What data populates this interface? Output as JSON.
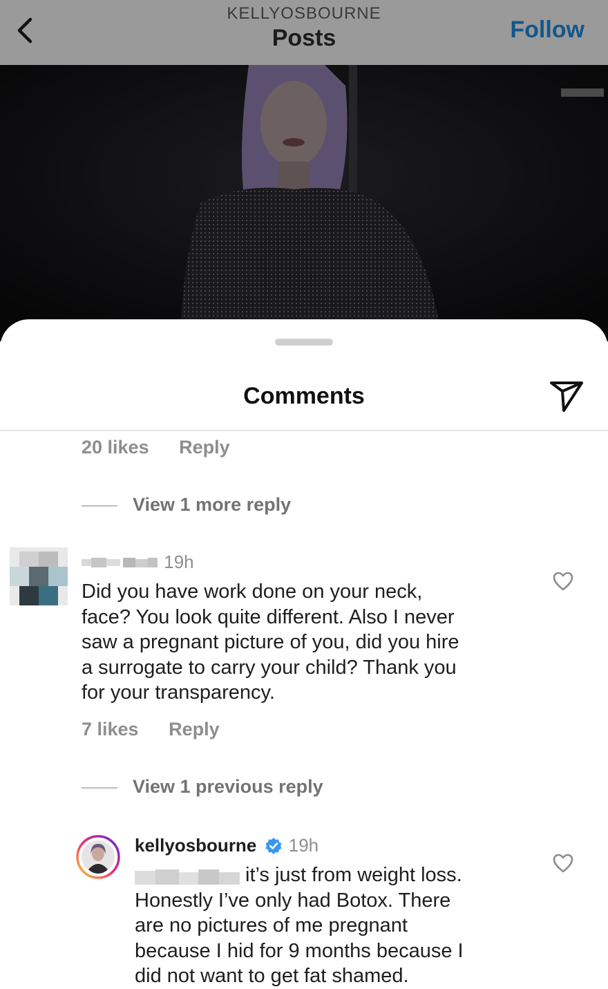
{
  "header": {
    "account": "KELLYOSBOURNE",
    "title": "Posts",
    "follow_label": "Follow"
  },
  "sheet": {
    "title": "Comments"
  },
  "comments": [
    {
      "likes": "20 likes",
      "reply_label": "Reply",
      "view_more": "View 1 more reply"
    },
    {
      "time": "19h",
      "text": "Did you have work done on your neck,\nface? You look quite different. Also I never\nsaw a pregnant picture of you, did you hire\na surrogate to carry your child? Thank you\nfor your transparency.",
      "likes": "7 likes",
      "reply_label": "Reply",
      "view_more": "View 1 previous reply"
    },
    {
      "username": "kellyosbourne",
      "verified": true,
      "time": "19h",
      "text": "it’s just from weight loss.\nHonestly I’ve only had Botox. There\nare no pictures of me pregnant\nbecause I hid for 9 months because I\ndid not want to get fat shamed."
    }
  ],
  "colors": {
    "follow": "#12578a",
    "verified": "#3897f0",
    "muted": "#8e8e8e",
    "text": "#1e1e1e"
  },
  "icons": [
    "chevron-left-icon",
    "share-icon",
    "heart-icon",
    "verified-badge-icon"
  ]
}
